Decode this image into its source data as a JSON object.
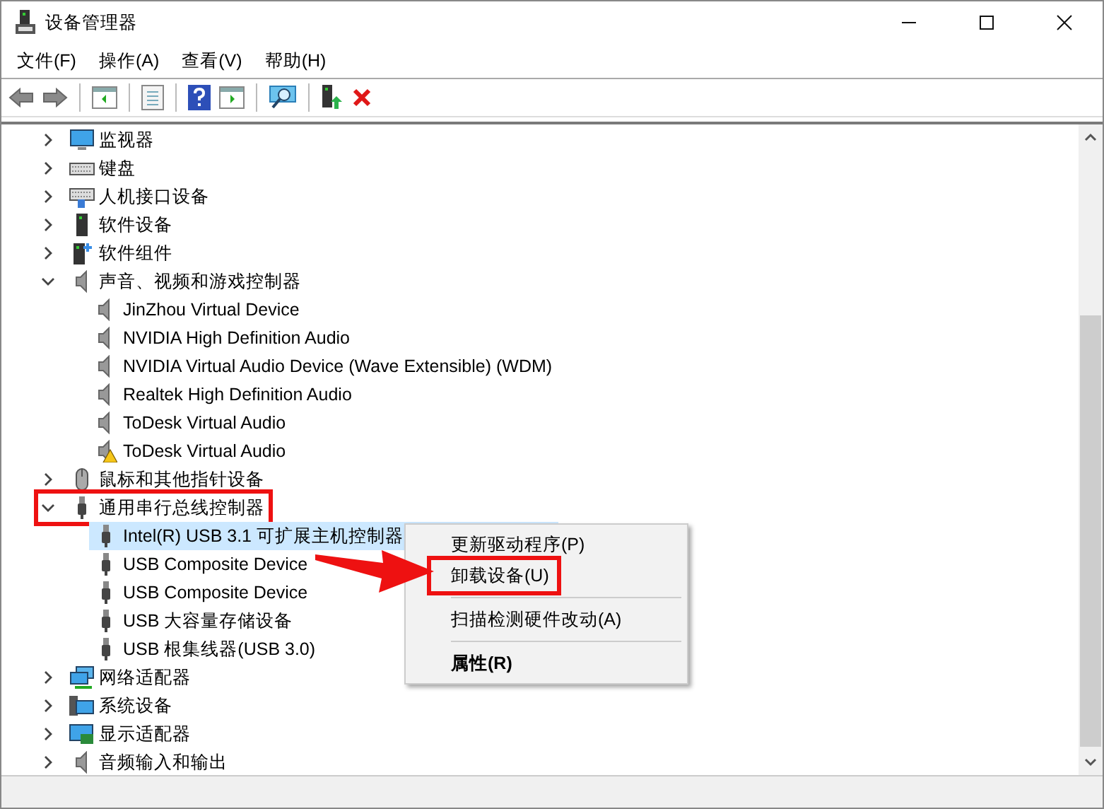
{
  "window": {
    "title": "设备管理器"
  },
  "menu_bar": [
    "文件(F)",
    "操作(A)",
    "查看(V)",
    "帮助(H)"
  ],
  "tree": {
    "items": [
      {
        "label": "监视器",
        "kind": "monitor",
        "expanded": false,
        "annotated": false
      },
      {
        "label": "键盘",
        "kind": "keyboard",
        "expanded": false,
        "annotated": false
      },
      {
        "label": "人机接口设备",
        "kind": "hid",
        "expanded": false,
        "annotated": false
      },
      {
        "label": "软件设备",
        "kind": "softdev",
        "expanded": false,
        "annotated": false
      },
      {
        "label": "软件组件",
        "kind": "softcomp",
        "expanded": false,
        "annotated": false
      },
      {
        "label": "声音、视频和游戏控制器",
        "kind": "sound",
        "expanded": true,
        "annotated": false,
        "children": [
          {
            "label": "JinZhou Virtual Device",
            "kind": "sound",
            "selected": false,
            "warning": false
          },
          {
            "label": "NVIDIA High Definition Audio",
            "kind": "sound",
            "selected": false,
            "warning": false
          },
          {
            "label": "NVIDIA Virtual Audio Device (Wave Extensible) (WDM)",
            "kind": "sound",
            "selected": false,
            "warning": false
          },
          {
            "label": "Realtek High Definition Audio",
            "kind": "sound",
            "selected": false,
            "warning": false
          },
          {
            "label": "ToDesk Virtual Audio",
            "kind": "sound",
            "selected": false,
            "warning": false
          },
          {
            "label": "ToDesk Virtual Audio",
            "kind": "sound",
            "selected": false,
            "warning": true
          }
        ]
      },
      {
        "label": "鼠标和其他指针设备",
        "kind": "mouse",
        "expanded": false,
        "annotated": false
      },
      {
        "label": "通用串行总线控制器",
        "kind": "usb",
        "expanded": true,
        "annotated": true,
        "children": [
          {
            "label": "Intel(R) USB 3.1 可扩展主机控制器",
            "kind": "usb",
            "selected": true,
            "warning": false
          },
          {
            "label": "USB Composite Device",
            "kind": "usb",
            "selected": false,
            "warning": false
          },
          {
            "label": "USB Composite Device",
            "kind": "usb",
            "selected": false,
            "warning": false
          },
          {
            "label": "USB 大容量存储设备",
            "kind": "usb",
            "selected": false,
            "warning": false
          },
          {
            "label": "USB 根集线器(USB 3.0)",
            "kind": "usb",
            "selected": false,
            "warning": false
          }
        ]
      },
      {
        "label": "网络适配器",
        "kind": "network",
        "expanded": false,
        "annotated": false
      },
      {
        "label": "系统设备",
        "kind": "system",
        "expanded": false,
        "annotated": false
      },
      {
        "label": "显示适配器",
        "kind": "display",
        "expanded": false,
        "annotated": false
      },
      {
        "label": "音频输入和输出",
        "kind": "sound",
        "expanded": false,
        "annotated": false
      }
    ]
  },
  "context_menu": {
    "groups": [
      [
        {
          "label": "更新驱动程序(P)",
          "bold": false,
          "annotated": false
        },
        {
          "label": "卸载设备(U)",
          "bold": false,
          "annotated": true
        }
      ],
      [
        {
          "label": "扫描检测硬件改动(A)",
          "bold": false,
          "annotated": false
        }
      ],
      [
        {
          "label": "属性(R)",
          "bold": true,
          "annotated": false
        }
      ]
    ]
  }
}
